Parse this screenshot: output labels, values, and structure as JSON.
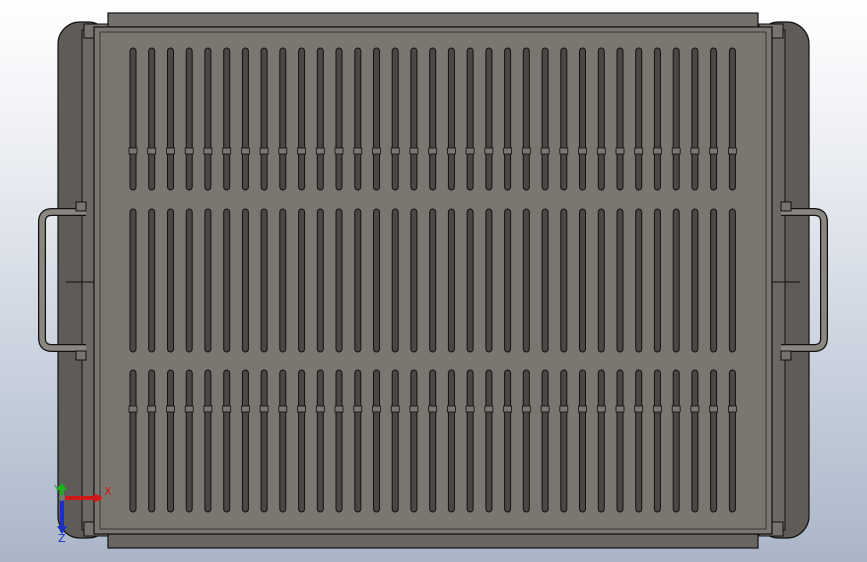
{
  "viewport": {
    "background_top": "#ffffff",
    "background_bottom": "#aab6c8"
  },
  "model": {
    "name": "perforated-tray",
    "colors": {
      "tray_face": "#7a7670",
      "tray_side": "#67645f",
      "tray_dark": "#4f4c48",
      "slot": "#4a4744",
      "edge": "#111111"
    },
    "slot_columns": 33,
    "slot_rows": 3
  },
  "triad": {
    "x_label": "X",
    "y_label": "Y",
    "z_label": "Z",
    "x_color": "#d01818",
    "y_color": "#18b018",
    "z_color": "#1830c8"
  }
}
